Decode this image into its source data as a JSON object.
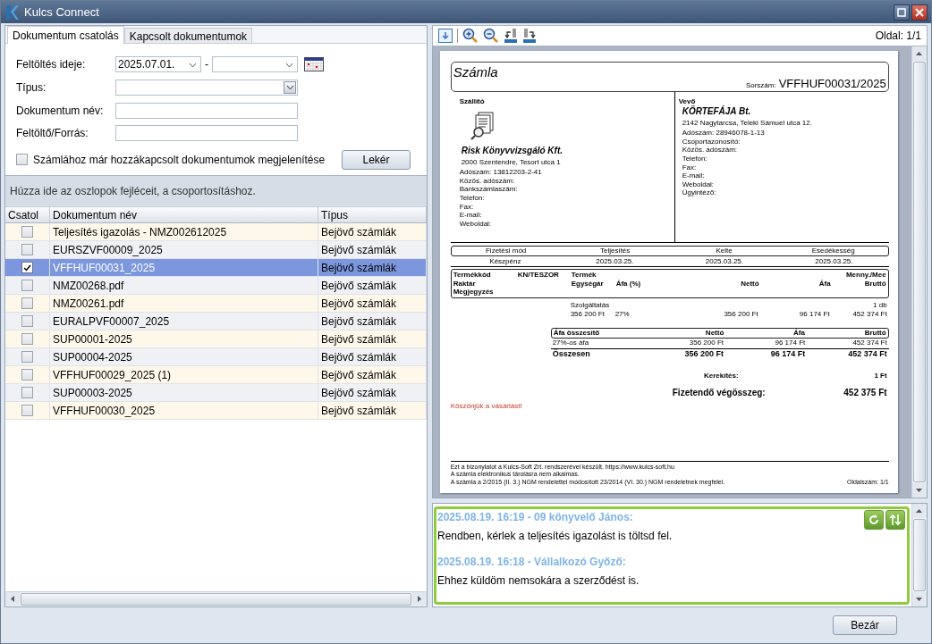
{
  "window": {
    "title": "Kulcs Connect"
  },
  "tabs": [
    {
      "label": "Dokumentum csatolás",
      "selected": true
    },
    {
      "label": "Kapcsolt dokumentumok",
      "selected": false
    }
  ],
  "filters": {
    "upload_date_label": "Feltöltés ideje:",
    "date_from": "2025.07.01.",
    "date_separator": "-",
    "type_label": "Típus:",
    "document_name_label": "Dokumentum név:",
    "uploader_label": "Feltöltő/Forrás:",
    "show_linked": {
      "label": "Számlához már hozzákapcsolt dokumentumok megjelenítése",
      "checked": false
    },
    "fetch_button": "Lekér"
  },
  "group_hint": "Húzza ide az oszlopok fejléceit, a csoportosításhoz.",
  "table": {
    "columns": [
      "Csatol",
      "Dokumentum név",
      "Típus"
    ],
    "rows": [
      {
        "attach": false,
        "selected": false,
        "name": "Teljesítés igazolás - NMZ002612025",
        "type": "Bejövő számlák"
      },
      {
        "attach": false,
        "selected": false,
        "name": "EURSZVF00009_2025",
        "type": "Bejövő számlák"
      },
      {
        "attach": true,
        "selected": true,
        "name": "VFFHUF00031_2025",
        "type": "Bejövő számlák"
      },
      {
        "attach": false,
        "selected": false,
        "name": "NMZ00268.pdf",
        "type": "Bejövő számlák"
      },
      {
        "attach": false,
        "selected": false,
        "name": "NMZ00261.pdf",
        "type": "Bejövő számlák"
      },
      {
        "attach": false,
        "selected": false,
        "name": "EURALPVF00007_2025",
        "type": "Bejövő számlák"
      },
      {
        "attach": false,
        "selected": false,
        "name": "SUP00001-2025",
        "type": "Bejövő számlák"
      },
      {
        "attach": false,
        "selected": false,
        "name": "SUP00004-2025",
        "type": "Bejövő számlák"
      },
      {
        "attach": false,
        "selected": false,
        "name": "VFFHUF00029_2025 (1)",
        "type": "Bejövő számlák"
      },
      {
        "attach": false,
        "selected": false,
        "name": "SUP00003-2025",
        "type": "Bejövő számlák"
      },
      {
        "attach": false,
        "selected": false,
        "name": "VFFHUF00030_2025",
        "type": "Bejövő számlák"
      }
    ]
  },
  "preview": {
    "page_label": "Oldal: 1/1",
    "invoice": {
      "title": "Számla",
      "number_label": "Sorszám:",
      "number": "VFFHUF00031/2025",
      "seller": {
        "heading": "Szállító",
        "name": "Risk Könyvvizsgáló Kft.",
        "address": "2000 Szentendre, Tesort utca 1",
        "lines": [
          "Adószám: 13812203-2-41",
          "Közös. adószám:",
          "Bankszámlaszám:",
          "Telefon:",
          "Fax:",
          "E-mail:",
          "Weboldal:"
        ]
      },
      "buyer": {
        "heading": "Vevő",
        "name": "KÖRTEFÁJA Bt.",
        "address": "2142 Nagytarcsa, Teleki Sámuel utca 12.",
        "lines": [
          "Adószám: 28946078-1-13",
          "Csoportazonosító:",
          "Közös. adószám:",
          "Telefon:",
          "Fax:",
          "E-mail:",
          "Weboldal:",
          "Ügyintéző:"
        ]
      },
      "payment": {
        "columns": [
          "Fizetési mód",
          "Teljesítés",
          "Kelte",
          "Esedékesség"
        ],
        "values": [
          "Készpénz",
          "2025.03.25.",
          "2025.03.25.",
          "2025.03.25."
        ]
      },
      "item_header": {
        "code": "Termékkód",
        "kn": "KN/TESZOR",
        "product": "Termék",
        "quantity": "Menny./Mee",
        "warehouse": "Raktár",
        "unit_price": "Egységár",
        "vat_rate": "Áfa (%)",
        "net": "Nettó",
        "vat": "Áfa",
        "gross": "Bruttó",
        "note": "Megjegyzés"
      },
      "item": {
        "product": "Szolgáltatás",
        "quantity": "1 db",
        "unit_price": "356 200 Ft",
        "vat_rate": "27%",
        "net": "356 200 Ft",
        "vat": "96 174 Ft",
        "gross": "452 374 Ft"
      },
      "vat_summary": {
        "columns": [
          "Áfa összesítő",
          "Nettó",
          "Áfa",
          "Bruttó"
        ],
        "rows": [
          [
            "27%-os áfa",
            "356 200 Ft",
            "96 174 Ft",
            "452 374 Ft"
          ],
          [
            "Összesen",
            "356 200 Ft",
            "96 174 Ft",
            "452 374 Ft"
          ]
        ]
      },
      "rounding": {
        "label": "Kerekítés:",
        "value": "1 Ft"
      },
      "total": {
        "label": "Fizetendő végösszeg:",
        "value": "452 375 Ft"
      },
      "thanks": "Köszönjük a vásárlást!",
      "footer_lines": [
        "Ezt a bizonylatot a Kulcs-Soft Zrt. rendszerével készült. https://www.kulcs-soft.hu",
        "A számla elektronikus tárolásra nem alkalmas.",
        "A számla a 2/2015 (II. 3.) NGM rendelettel módosított 23/2014 (VI. 30.) NGM rendeletnek megfelel."
      ],
      "page_number": "Oldalszám: 1/1"
    }
  },
  "messages": [
    {
      "header": "2025.08.19. 16:19 - 09 könyvelő János:",
      "text": "Rendben, kérlek a teljesítés igazolást is töltsd fel."
    },
    {
      "header": "2025.08.19. 16:18 - Vállalkozó Győző:",
      "text": "Ehhez küldöm nemsokára a szerződést is."
    }
  ],
  "close_button": "Bezár"
}
